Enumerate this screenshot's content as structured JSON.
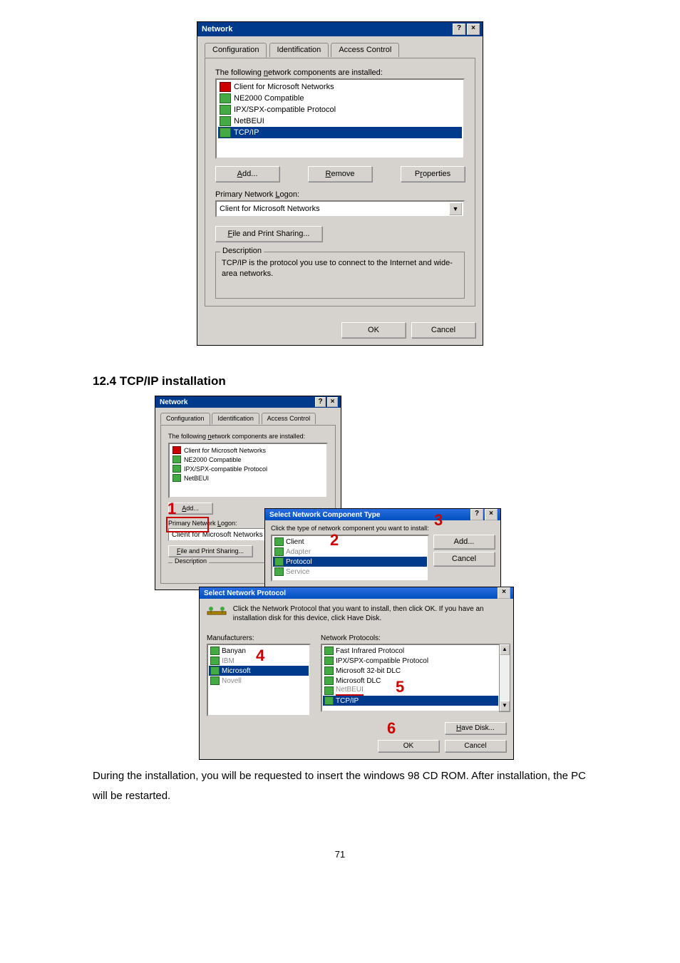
{
  "section_heading": "12.4 TCP/IP installation",
  "dlg1": {
    "title": "Network",
    "tabs": {
      "t1": "Configuration",
      "t2": "Identification",
      "t3": "Access Control"
    },
    "comp_label_prefix": "The following ",
    "comp_u": "n",
    "comp_label_suffix": "etwork components are installed:",
    "items": {
      "i1": "Client for Microsoft Networks",
      "i2": "NE2000 Compatible",
      "i3": "IPX/SPX-compatible Protocol",
      "i4": "NetBEUI",
      "i5": "TCP/IP"
    },
    "btn_add_u": "A",
    "btn_add_rest": "dd...",
    "btn_remove_u": "R",
    "btn_remove_rest": "emove",
    "btn_props_prefix": "P",
    "btn_props_u": "r",
    "btn_props_rest": "operties",
    "primary_label_prefix": "Primary Network ",
    "primary_u": "L",
    "primary_label_suffix": "ogon:",
    "primary_value": "Client for Microsoft Networks",
    "fps_btn_u": "F",
    "fps_btn_rest": "ile and Print Sharing...",
    "desc_title": "Description",
    "desc_text": "TCP/IP is the protocol you use to connect to the Internet and wide-area networks.",
    "ok": "OK",
    "cancel": "Cancel"
  },
  "snct": {
    "title": "Select Network Component Type",
    "instruction": "Click the type of network component you want to install:",
    "items": {
      "i1": "Client",
      "i2": "Adapter",
      "i3": "Protocol",
      "i4": "Service"
    },
    "add": "Add...",
    "cancel": "Cancel",
    "descrip_blank": ""
  },
  "snp": {
    "title": "Select Network Protocol",
    "desc": "Click the Network Protocol that you want to install, then click OK. If you have an installation disk for this device, click Have Disk.",
    "mf_label": "Manufacturers:",
    "np_label": "Network Protocols:",
    "mf": {
      "m1": "Banyan",
      "m2": "IBM",
      "m3": "Microsoft",
      "m4": "Novell"
    },
    "np": {
      "p1": "Fast Infrared Protocol",
      "p2": "IPX/SPX-compatible Protocol",
      "p3": "Microsoft 32-bit DLC",
      "p4": "Microsoft DLC",
      "p5": "NetBEUI",
      "p6": "TCP/IP"
    },
    "have_disk_u": "H",
    "have_disk_rest": "ave Disk...",
    "ok": "OK",
    "cancel": "Cancel"
  },
  "numbers": {
    "n1": "1",
    "n2": "2",
    "n3": "3",
    "n4": "4",
    "n5": "5",
    "n6": "6"
  },
  "body_text": "During the installation, you will be requested to insert the windows 98 CD ROM. After installation, the PC will be restarted.",
  "page_number": "71"
}
